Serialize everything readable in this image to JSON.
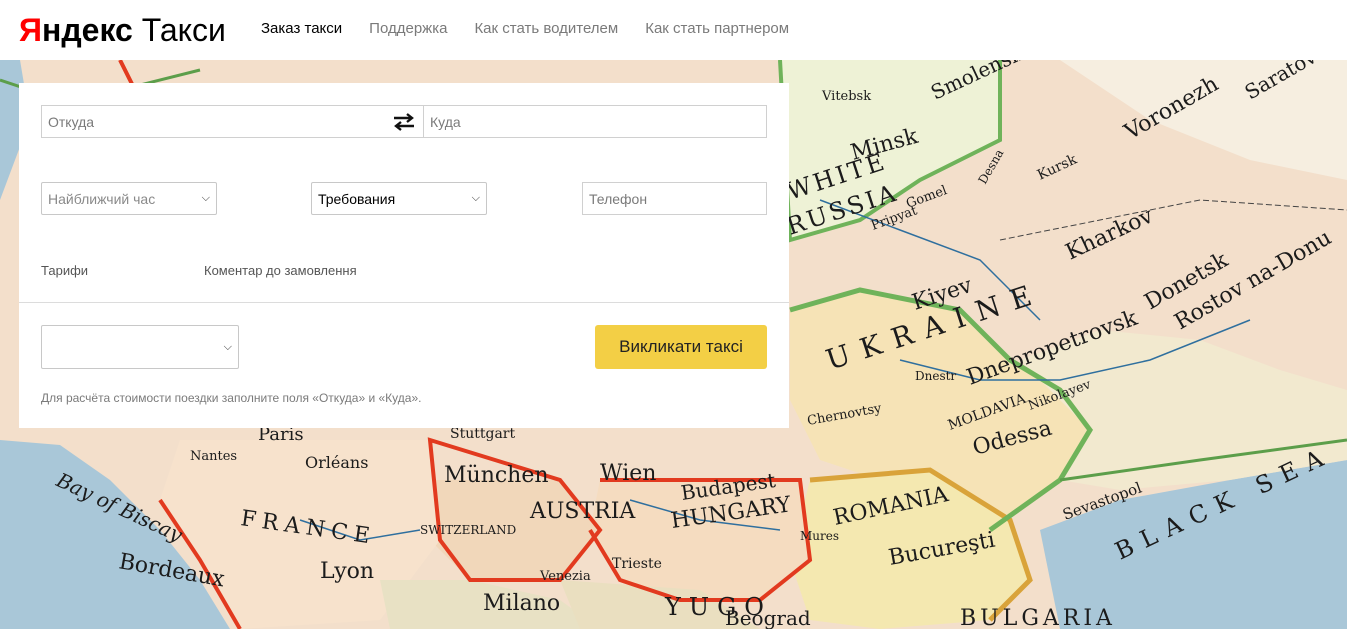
{
  "header": {
    "logo_ya": "Я",
    "logo_ndeks": "ндекс",
    "logo_taxi": "Такси",
    "nav": [
      {
        "label": "Заказ такси",
        "active": true
      },
      {
        "label": "Поддержка"
      },
      {
        "label": "Как стать водителем"
      },
      {
        "label": "Как стать партнером"
      }
    ]
  },
  "form": {
    "from_placeholder": "Откуда",
    "to_placeholder": "Куда",
    "time_value": "Найближчий час",
    "requirements_value": "Требования",
    "phone_placeholder": "Телефон",
    "tariffs_link": "Тарифи",
    "comment_link": "Коментар до замовлення",
    "payment_value": "",
    "call_button": "Викликати таксі",
    "hint": "Для расчёта стоимости поездки заполните поля «Откуда» и «Куда»."
  },
  "icons": {
    "swap": "swap-arrows-icon"
  },
  "colors": {
    "brand_red": "#ff0000",
    "accent_yellow": "#f3cf45"
  },
  "map": {
    "labels": [
      {
        "text": "Smolensk"
      },
      {
        "text": "Vitebsk"
      },
      {
        "text": "Minsk"
      },
      {
        "text": "WHITE"
      },
      {
        "text": "RUSSIA"
      },
      {
        "text": "Voronezh"
      },
      {
        "text": "Saratov"
      },
      {
        "text": "Kursk"
      },
      {
        "text": "Kharkov"
      },
      {
        "text": "Kiyev"
      },
      {
        "text": "Donetsk"
      },
      {
        "text": "Rostov na-Donu"
      },
      {
        "text": "Dnepropetrovsk"
      },
      {
        "text": "UKRAINE"
      },
      {
        "text": "Odessa"
      },
      {
        "text": "Nikolayev"
      },
      {
        "text": "MOLDAVIA"
      },
      {
        "text": "Sevastopol"
      },
      {
        "text": "BLACK SEA"
      },
      {
        "text": "ROMANIA"
      },
      {
        "text": "Bucureşti"
      },
      {
        "text": "Budapest"
      },
      {
        "text": "HUNGARY"
      },
      {
        "text": "Wien"
      },
      {
        "text": "AUSTRIA"
      },
      {
        "text": "München"
      },
      {
        "text": "Stuttgart"
      },
      {
        "text": "SWITZERLAND"
      },
      {
        "text": "FRANCE"
      },
      {
        "text": "Lyon"
      },
      {
        "text": "Bordeaux"
      },
      {
        "text": "Bay of Biscay"
      },
      {
        "text": "Orléans"
      },
      {
        "text": "Nantes"
      },
      {
        "text": "Milano"
      },
      {
        "text": "Venezia"
      },
      {
        "text": "Trieste"
      },
      {
        "text": "YUGO"
      },
      {
        "text": "Beograd"
      },
      {
        "text": "BULGARIA"
      },
      {
        "text": "Paris"
      },
      {
        "text": "Chernovtsy"
      },
      {
        "text": "Mures"
      },
      {
        "text": "Gomel"
      },
      {
        "text": "Pripyat"
      },
      {
        "text": "Dnestr"
      },
      {
        "text": "Desna"
      }
    ]
  }
}
